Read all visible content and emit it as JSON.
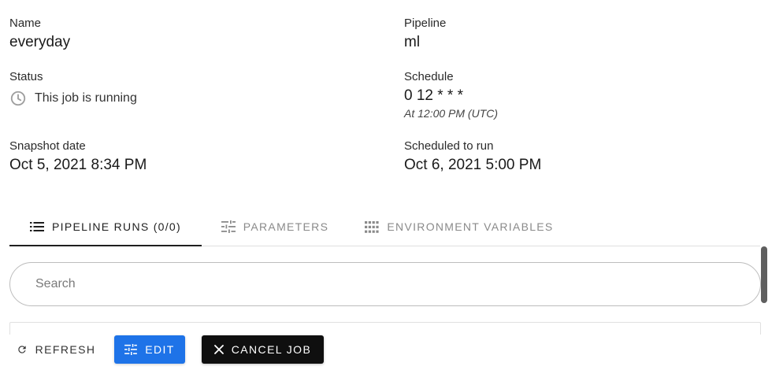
{
  "details": {
    "name": {
      "label": "Name",
      "value": "everyday"
    },
    "pipeline": {
      "label": "Pipeline",
      "value": "ml"
    },
    "status": {
      "label": "Status",
      "value": "This job is running"
    },
    "schedule": {
      "label": "Schedule",
      "value": "0 12 * * *",
      "description": "At 12:00 PM (UTC)"
    },
    "snapshot_date": {
      "label": "Snapshot date",
      "value": "Oct 5, 2021 8:34 PM"
    },
    "scheduled_to_run": {
      "label": "Scheduled to run",
      "value": "Oct 6, 2021 5:00 PM"
    }
  },
  "tabs": [
    {
      "label": "Pipeline runs (0/0)",
      "icon": "list-icon",
      "active": true
    },
    {
      "label": "Parameters",
      "icon": "tune-icon",
      "active": false
    },
    {
      "label": "Environment variables",
      "icon": "grid-icon",
      "active": false
    }
  ],
  "search": {
    "placeholder": "Search",
    "value": ""
  },
  "actions": {
    "refresh_label": "Refresh",
    "edit_label": "Edit",
    "cancel_label": "Cancel job"
  },
  "colors": {
    "primary": "#1e73e8",
    "dark_button": "#0f0f0f",
    "status_icon": "#9e9e9e"
  }
}
